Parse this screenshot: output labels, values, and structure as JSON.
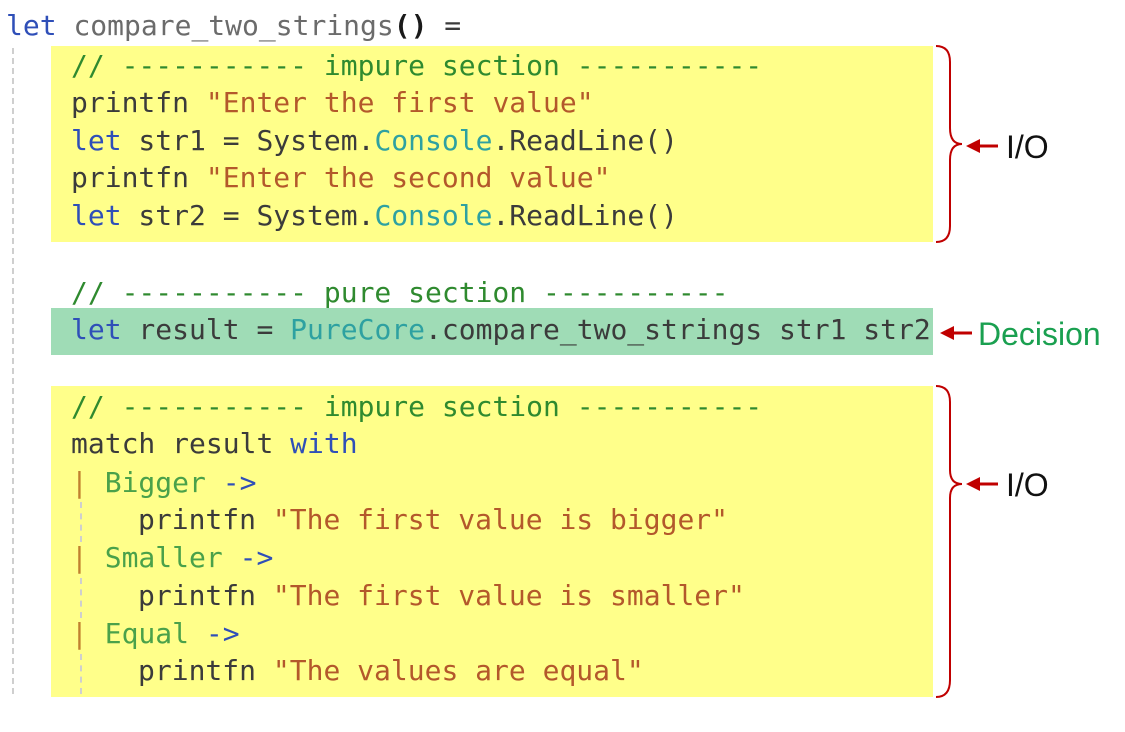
{
  "code": {
    "fn_keyword": "let",
    "fn_name": "compare_two_strings",
    "fn_parens": "()",
    "fn_eq": " =",
    "impure_comment_1": "// ----------- impure section -----------",
    "l_printfn_1": "printfn",
    "l_str_1": "\"Enter the first value\"",
    "l_let_1": "let",
    "l_str1_assign": " str1 = System.",
    "l_console": "Console",
    "l_readline": ".ReadLine()",
    "l_printfn_2": "printfn",
    "l_str_2": "\"Enter the second value\"",
    "l_let_2": "let",
    "l_str2_assign": " str2 = System.",
    "pure_comment": "// ----------- pure section -----------",
    "l_let_3": "let",
    "l_result_assign": " result = ",
    "l_purecore": "PureCore",
    "l_compare_call": ".compare_two_strings str1 str2",
    "impure_comment_2": "// ----------- impure section -----------",
    "l_match": "match",
    "l_result_with_1": " result ",
    "l_with": "with",
    "pipe": "|",
    "case_bigger": "Bigger",
    "case_smaller": "Smaller",
    "case_equal": "Equal",
    "arrow": "->",
    "printfn": "printfn",
    "str_bigger": "\"The first value is bigger\"",
    "str_smaller": "\"The first value is smaller\"",
    "str_equal": "\"The values are equal\""
  },
  "annotations": {
    "io_top": "I/O",
    "decision": "Decision",
    "io_bottom": "I/O"
  },
  "colors": {
    "impure_bg": "#ffff8a",
    "pure_bg": "#9fdcb6",
    "bracket": "#c00000",
    "decision_text": "#1aa050"
  }
}
